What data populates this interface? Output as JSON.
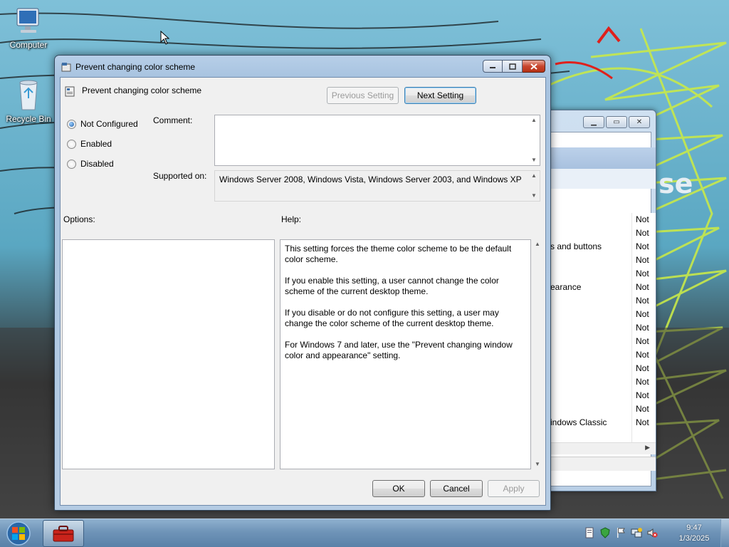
{
  "desktop": {
    "icons": [
      {
        "label": "Computer",
        "icon": "computer-icon"
      },
      {
        "label": "Recycle Bin",
        "icon": "recycle-bin-icon"
      }
    ],
    "wallpaper_overlay_text": "se"
  },
  "background_window": {
    "rows": [
      {
        "name": "",
        "state": "Not"
      },
      {
        "name": "",
        "state": "Not"
      },
      {
        "name": "s and buttons",
        "state": "Not"
      },
      {
        "name": "",
        "state": "Not"
      },
      {
        "name": "",
        "state": "Not"
      },
      {
        "name": "earance",
        "state": "Not"
      },
      {
        "name": "",
        "state": "Not"
      },
      {
        "name": "",
        "state": "Not"
      },
      {
        "name": "",
        "state": "Not"
      },
      {
        "name": "",
        "state": "Not"
      },
      {
        "name": "",
        "state": "Not"
      },
      {
        "name": "",
        "state": "Not"
      },
      {
        "name": "",
        "state": "Not"
      },
      {
        "name": "",
        "state": "Not"
      },
      {
        "name": "",
        "state": "Not"
      },
      {
        "name": "indows Classic",
        "state": "Not"
      }
    ]
  },
  "dialog": {
    "window_title": "Prevent changing color scheme",
    "setting_title": "Prevent changing color scheme",
    "prev_button": "Previous Setting",
    "next_button": "Next Setting",
    "options": {
      "not_configured": "Not Configured",
      "enabled": "Enabled",
      "disabled": "Disabled",
      "selected": "not_configured"
    },
    "comment_label": "Comment:",
    "comment_value": "",
    "supported_label": "Supported on:",
    "supported_value": "Windows Server 2008, Windows Vista, Windows Server 2003, and Windows XP",
    "options_label": "Options:",
    "help_label": "Help:",
    "help_paragraphs": [
      "This setting forces the theme color scheme to be the default color scheme.",
      "If you enable this setting, a user cannot change the color scheme of the current desktop theme.",
      "If you disable or do not configure this setting, a user may change the color scheme of the current desktop theme.",
      "For Windows 7 and later, use the \"Prevent changing window color and appearance\" setting."
    ],
    "ok_button": "OK",
    "cancel_button": "Cancel",
    "apply_button": "Apply"
  },
  "taskbar": {
    "time": "9:47",
    "date": "1/3/2025",
    "tray_icons": [
      "action-center-icon",
      "flag-icon",
      "network-icon",
      "volume-muted-icon",
      "document-icon",
      "shield-icon"
    ],
    "accent_color": "#5a81a8"
  }
}
